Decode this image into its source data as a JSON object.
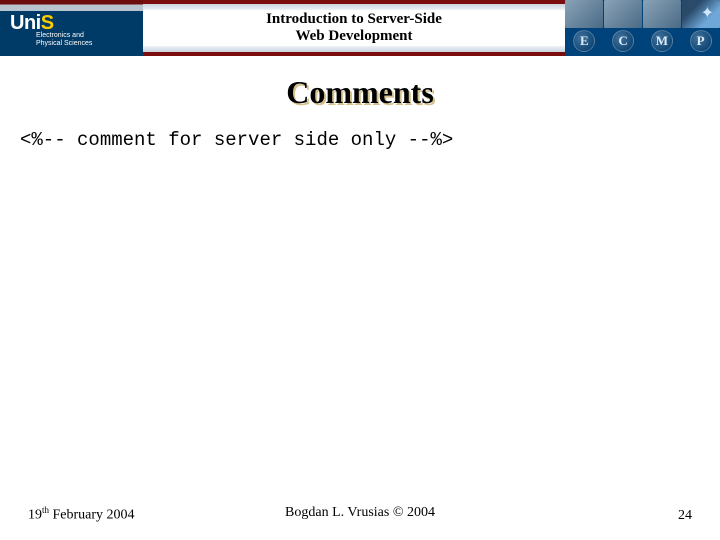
{
  "header": {
    "logo_text": "Uni",
    "logo_dot": "S",
    "department_line1": "Electronics and",
    "department_line2": "Physical Sciences",
    "course_title_line1": "Introduction to Server-Side",
    "course_title_line2": "Web Development",
    "badge_letters": [
      "E",
      "C",
      "M",
      "P"
    ]
  },
  "slide": {
    "title": "Comments",
    "code": "<%-- comment for server side only --%>"
  },
  "footer": {
    "date_prefix": "19",
    "date_suffix": "th",
    "date_rest": " February 2004",
    "author": "Bogdan L. Vrusias © 2004",
    "page_number": "24"
  }
}
